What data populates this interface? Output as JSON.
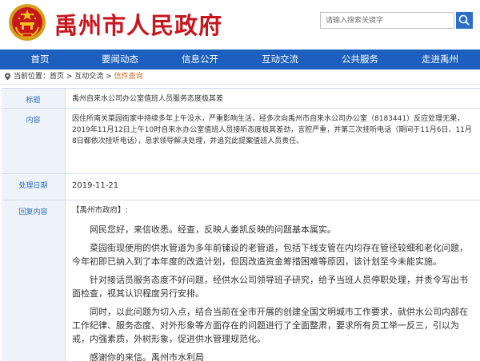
{
  "header": {
    "site_title": "禹州市人民政府",
    "search_placeholder": "请输入搜索关键字"
  },
  "nav": {
    "items": [
      "首页",
      "要闻动态",
      "信息公开",
      "互动交流",
      "公共服务",
      "走进禹州"
    ]
  },
  "breadcrumb": {
    "prefix": "当前位置：",
    "home": "首页",
    "sep1": " > ",
    "section": "互动交流",
    "sep2": " > ",
    "current": "信件查询"
  },
  "letter": {
    "title_label": "标题",
    "title_value": "禹州自来水公司办公室值班人员服务态度极其差",
    "content_label": "内容",
    "content_value": "因住所南关菜园街家中持续多年上午没水，严重影响生活，经多次向禹州市自来水公司办公室（8183441）反应处理无果，2019年11月12日上午10时自来水办公室值班人员接听态度极其差劲，言腔严重，并第三次挂听电话（期间于11月6日、11月8日都依次挂听电话），恳求领导解决处理，并追究此提案值班人员责任。",
    "date_label": "处理日期",
    "date_value": "2019-11-21",
    "reply_label": "回复内容",
    "reply_header": "【禹州市政府】:",
    "reply_paragraphs": [
      "网民您好，来信收悉。经查，反映人娄凯反映的问题基本属实。",
      "菜园街现使用的供水管道为多年前铺设的老管道，包括下线支管在内均存在管径较细和老化问题，今年初即已纳入到了本年度的改造计划，但因改造资金筹措困难等原因，该计划至今未能实施。",
      "针对接话员服务态度不好问题，经供水公司领导班子研究，给予当班人员停职处理，并责令写出书面检查，视其认识程度另行安排。",
      "同时，以此问题为切入点，结合当前在全市开展的创建全国文明城市工作要求，就供水公司内部在工作纪律、服务态度、对外形象等方面存在的问题进行了全面整肃，要求所有员工举一反三，引以为戒，内强素质，外树形象，促进供水管理规范化。",
      "感谢你的来信。禹州市水利局"
    ]
  },
  "colors": {
    "brand_red": "#c8161d",
    "nav_blue": "#1d5fbf",
    "label_blue": "#2a6fcb",
    "breadcrumb_current": "#d2691e"
  },
  "icons": {
    "emblem": "national-emblem-icon",
    "search": "search-icon",
    "breadcrumb": "location-pin-icon"
  }
}
